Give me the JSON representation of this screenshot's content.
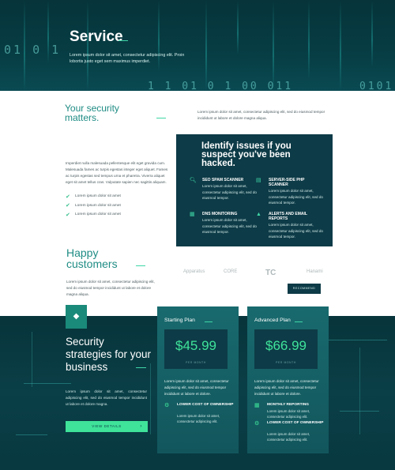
{
  "hero": {
    "title": "Service",
    "subtitle": "Lorem ipsum dolor sit amet, consectetur adipiscing elit. Proin lobortis justo eget sem maximus imperdiet.",
    "digits_1": "01 0 1",
    "digits_2": "1 1    01 0 1  00  011",
    "digits_3": "0101"
  },
  "security": {
    "title_line1": "Your security",
    "title_line2": "matters.",
    "description": "Lorem ipsum dolor sit amet, consectetur adipiscing elit, sed do eiusmod tempor incididunt ut labore et dolore magna aliqua.",
    "left_paragraph": "Imperdiet nulla malesuada pellentesque elit eget gravida cum. Malesuada fames ac turpis egestas integer eget aliquet. Fames ac turpis egestas sed tempus urna et pharetra. Viverra aliquet eget sit amet tellus cras. Vulputate sapien nec sagittis aliquam.",
    "checks": [
      "Lorem ipsum dolor sit amet",
      "Lorem ipsum dolor sit amet",
      "Lorem ipsum dolor sit amet"
    ]
  },
  "issues": {
    "title": "Identify issues if you suspect you've been hacked.",
    "features": [
      {
        "icon": "search-icon",
        "heading": "SEO SPAM SCANNER",
        "text": "Lorem ipsum dolor sit amet, consectetur adipiscing elit, sed do eiusmod tempor."
      },
      {
        "icon": "server-icon",
        "heading": "SERVER-SIDE PHP SCANNER",
        "text": "Lorem ipsum dolor sit amet, consectetur adipiscing elit, sed do eiusmod tempor."
      },
      {
        "icon": "grid-icon",
        "heading": "DNS MONITORING",
        "text": "Lorem ipsum dolor sit amet, consectetur adipiscing elit, sed do eiusmod tempor."
      },
      {
        "icon": "warning-icon",
        "heading": "ALERTS AND EMAIL REPORTS",
        "text": "Lorem ipsum dolor sit amet, consectetur adipiscing elit, sed do eiusmod tempor."
      }
    ]
  },
  "customers": {
    "title_line1": "Happy",
    "title_line2": "customers",
    "description": "Lorem ipsum dolor sit amet, consectetur adipiscing elit, sed do eiusmod tempor incididunt ut labore et dolore magna aliqua.",
    "logos": [
      "Apparatus",
      "CORE",
      "TC",
      "Hanami"
    ],
    "button": "RECOMMEND"
  },
  "strategies": {
    "title": "Security strategies for your business",
    "description": "Lorem ipsum dolor sit amet, consectetur adipiscing elit, sed do eiusmod tempor incididunt ut labore et dolore magna.",
    "button": "VIEW DETAILS",
    "button_arrow": "›"
  },
  "plans": [
    {
      "name": "Starting Plan",
      "price": "$45.99",
      "period": "PER MONTH",
      "description": "Lorem ipsum dolor sit amet, consectetur adipiscing elit, sed do eiusmod tempor incididunt ut labore et dolore.",
      "features": [
        {
          "icon": "gear-icon",
          "heading": "LOWER COST OF OWNERSHIP",
          "text": "Lorem ipsum dolor sit amet, consectetur adipiscing elit."
        }
      ]
    },
    {
      "name": "Advanced Plan",
      "price": "$66.99",
      "period": "PER MONTH",
      "description": "Lorem ipsum dolor sit amet, consectetur adipiscing elit, sed do eiusmod tempor incididunt ut labore et dolore.",
      "features": [
        {
          "icon": "grid-icon",
          "heading": "MONTHLY REPORTING",
          "text": "Lorem ipsum dolor sit amet, consectetur adipiscing elit."
        },
        {
          "icon": "gear-icon",
          "heading": "LOWER COST OF OWNERSHIP",
          "text": "Lorem ipsum dolor sit amet, consectetur adipiscing elit."
        }
      ]
    }
  ],
  "colors": {
    "accent": "#3fe39a",
    "teal_text": "#1f8c84",
    "dark_panel": "#0d3b47"
  }
}
